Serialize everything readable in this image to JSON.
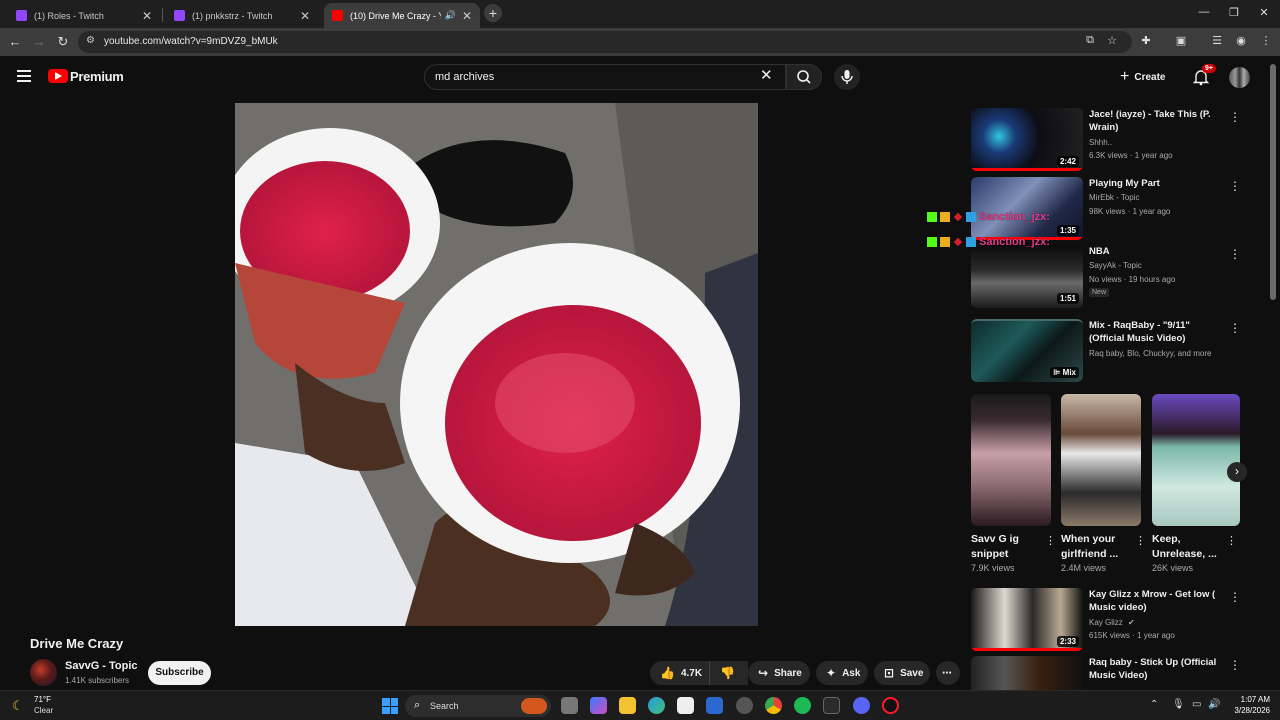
{
  "browser": {
    "tabs": [
      {
        "title": "(1) Roles - Twitch",
        "active": false
      },
      {
        "title": "(1) pnkkstrz - Twitch",
        "active": false
      },
      {
        "title": "(10) Drive Me Crazy - YouTube",
        "active": true
      }
    ],
    "url": "youtube.com/watch?v=9mDVZ9_bMUk"
  },
  "youtube": {
    "brand": "Premium",
    "search_query": "md archives",
    "create_label": "Create",
    "notification_badge": "9+"
  },
  "video": {
    "title": "Drive Me Crazy",
    "channel": "SavvG - Topic",
    "subscribers": "1.41K subscribers",
    "subscribe_label": "Subscribe",
    "likes": "4.7K",
    "share_label": "Share",
    "ask_label": "Ask",
    "save_label": "Save"
  },
  "recommendations": [
    {
      "title": "Jace! (iayze) - Take This (P. Wrain)",
      "channel": "Shhh..",
      "meta": "6.3K views · 1 year ago",
      "duration": "2:42",
      "watched": 1.0
    },
    {
      "title": "Playing My Part",
      "channel": "MirEbk - Topic",
      "meta": "98K views · 1 year ago",
      "duration": "1:35",
      "watched": 1.0
    },
    {
      "title": "NBA",
      "channel": "SayyAk - Topic",
      "meta": "No views · 19 hours ago",
      "duration": "1:51",
      "badge": "New"
    },
    {
      "title": "Mix - RaqBaby - \"9/11\" (Official Music Video)",
      "channel": "Raq baby, Blo, Chuckyy, and more",
      "duration": "Mix"
    },
    {
      "title": "Kay Glizz x Mrow - Get low ( Music video)",
      "channel": "Kay Glizz",
      "meta": "615K views · 1 year ago",
      "duration": "2:33",
      "watched": 1.0
    },
    {
      "title": "Raq baby - Stick Up (Official Music Video)"
    }
  ],
  "shorts": [
    {
      "title": "Savv G ig snippet",
      "views": "7.9K views"
    },
    {
      "title": "When your girlfriend ...",
      "views": "2.4M views"
    },
    {
      "title": "Keep, Unrelease, ...",
      "views": "26K views"
    }
  ],
  "chat_overlay": [
    {
      "user": "Sanction_jzx:"
    },
    {
      "user": "Sanction_jzx:"
    }
  ],
  "taskbar": {
    "temperature": "71°F",
    "condition": "Clear",
    "search_label": "Search",
    "time": "1:07 AM",
    "date": "3/28/2026"
  },
  "colors": {
    "youtube_red": "#ff0000",
    "background": "#0f0f0f",
    "overlay_pink": "#e63c8c"
  }
}
